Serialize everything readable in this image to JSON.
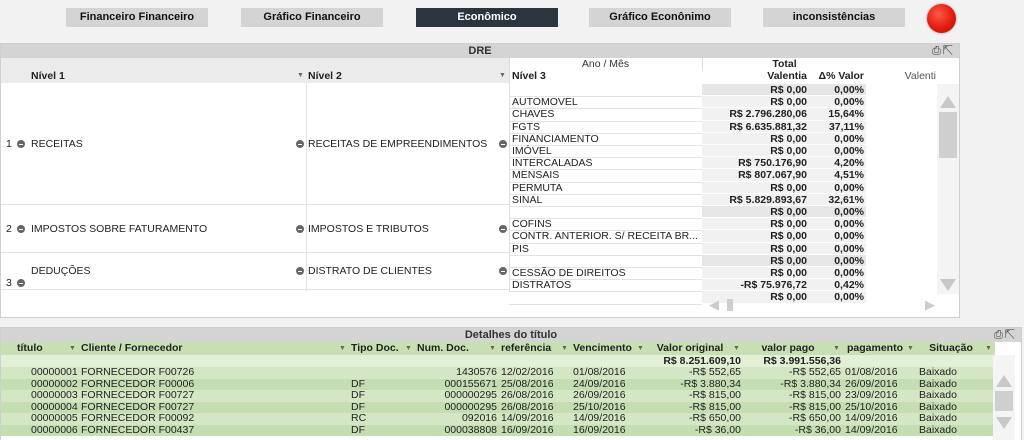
{
  "tabs": [
    "Financeiro Financeiro",
    "Gráfico Financeiro",
    "Econômico",
    "Gráfico Econônimo",
    "inconsistências"
  ],
  "active_tab": "Econômico",
  "dre": {
    "title": "DRE",
    "col_ano_mes": "Ano / Mês",
    "col_total": "Total",
    "col_nivel1": "Nível 1",
    "col_nivel2": "Nível 2",
    "col_nivel3": "Nível 3",
    "col_valentia": "Valentia",
    "col_delta": "Δ% Valor",
    "col_valentia2": "Valenti",
    "groups": [
      {
        "num": "1",
        "n1": "RECEITAS",
        "n2": "RECEITAS DE EMPREENDIMENTOS"
      },
      {
        "num": "2",
        "n1": "IMPOSTOS SOBRE FATURAMENTO",
        "n2": "IMPOSTOS E TRIBUTOS"
      },
      {
        "num": "3",
        "n1": "DEDUÇÕES",
        "n2": "DISTRATO DE CLIENTES"
      }
    ],
    "rows": [
      {
        "n3": "",
        "v": "R$ 0,00",
        "d": "0,00%",
        "bold": true
      },
      {
        "n3": "AUTOMOVEL",
        "v": "R$ 0,00",
        "d": "0,00%"
      },
      {
        "n3": "CHAVES",
        "v": "R$ 2.796.280,06",
        "d": "15,64%"
      },
      {
        "n3": "FGTS",
        "v": "R$ 6.635.881,32",
        "d": "37,11%"
      },
      {
        "n3": "FINANCIAMENTO",
        "v": "R$ 0,00",
        "d": "0,00%"
      },
      {
        "n3": "IMÓVEL",
        "v": "R$ 0,00",
        "d": "0,00%"
      },
      {
        "n3": "INTERCALADAS",
        "v": "R$ 750.176,90",
        "d": "4,20%"
      },
      {
        "n3": "MENSAIS",
        "v": "R$ 807.067,90",
        "d": "4,51%"
      },
      {
        "n3": "PERMUTA",
        "v": "R$ 0,00",
        "d": "0,00%"
      },
      {
        "n3": "SINAL",
        "v": "R$ 5.829.893,67",
        "d": "32,61%"
      },
      {
        "n3": "",
        "v": "R$ 0,00",
        "d": "0,00%",
        "bold": true
      },
      {
        "n3": "COFINS",
        "v": "R$ 0,00",
        "d": "0,00%"
      },
      {
        "n3": "CONTR. ANTERIOR. S/ RECEITA BR...",
        "v": "R$ 0,00",
        "d": "0,00%"
      },
      {
        "n3": "PIS",
        "v": "R$ 0,00",
        "d": "0,00%"
      },
      {
        "n3": "",
        "v": "R$ 0,00",
        "d": "0,00%",
        "bold": true
      },
      {
        "n3": "CESSÃO DE DIREITOS",
        "v": "R$ 0,00",
        "d": "0,00%"
      },
      {
        "n3": "DISTRATOS",
        "v": "-R$ 75.976,72",
        "d": "0,42%"
      },
      {
        "n3": "",
        "v": "R$ 0,00",
        "d": "0,00%"
      }
    ]
  },
  "det": {
    "title": "Detalhes do título",
    "headers": [
      "título",
      "Cliente / Fornecedor",
      "Tipo Doc.",
      "Num. Doc.",
      "referência",
      "Vencimento",
      "Valor original",
      "valor pago",
      "pagamento",
      "Situação"
    ],
    "total_original": "R$ 8.251.609,10",
    "total_pago": "R$ 3.991.556,36",
    "rows": [
      [
        "00000001",
        "FORNECEDOR F00726",
        "",
        "1430576",
        "12/02/2016",
        "01/08/2016",
        "-R$ 552,65",
        "-R$ 552,65",
        "01/08/2016",
        "Baixado"
      ],
      [
        "00000002",
        "FORNECEDOR F00006",
        "DF",
        "000155671",
        "25/08/2016",
        "24/09/2016",
        "-R$ 3.880,34",
        "-R$ 3.880,34",
        "26/09/2016",
        "Baixado"
      ],
      [
        "00000003",
        "FORNECEDOR F00727",
        "DF",
        "000000295",
        "26/08/2016",
        "26/09/2016",
        "-R$ 815,00",
        "-R$ 815,00",
        "23/09/2016",
        "Baixado"
      ],
      [
        "00000004",
        "FORNECEDOR F00727",
        "DF",
        "000000295",
        "26/08/2016",
        "25/10/2016",
        "-R$ 815,00",
        "-R$ 815,00",
        "25/10/2016",
        "Baixado"
      ],
      [
        "00000005",
        "FORNECEDOR F00092",
        "RC",
        "092016",
        "14/09/2016",
        "14/09/2016",
        "-R$ 650,00",
        "-R$ 650,00",
        "14/09/2016",
        "Baixado"
      ],
      [
        "00000006",
        "FORNECEDOR F00437",
        "DF",
        "000038808",
        "16/09/2016",
        "16/09/2016",
        "-R$ 36,00",
        "-R$ 36,00",
        "14/09/2016",
        "Baixado"
      ]
    ]
  }
}
